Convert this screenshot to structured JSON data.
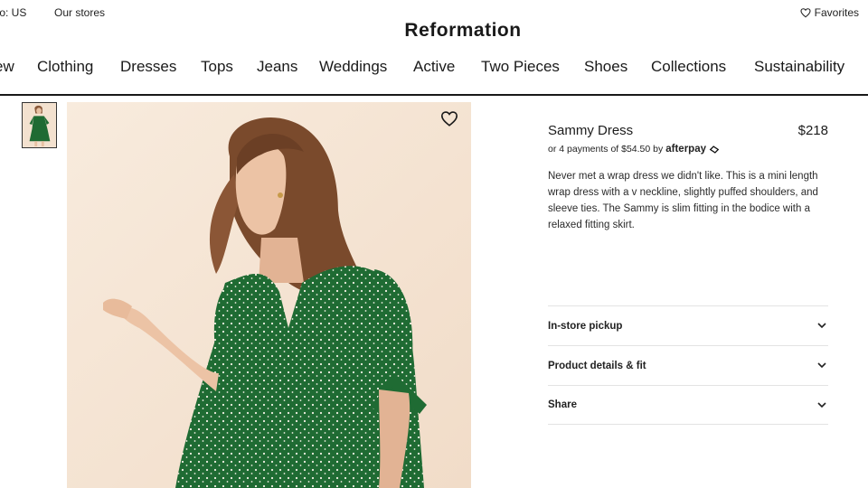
{
  "utility": {
    "ship_to": "to: US",
    "stores": "Our stores",
    "favorites": "Favorites"
  },
  "brand": {
    "logo": "Reformation"
  },
  "nav": {
    "items": [
      "ew",
      "Clothing",
      "Dresses",
      "Tops",
      "Jeans",
      "Weddings",
      "Active",
      "Two Pieces",
      "Shoes",
      "Collections",
      "Sustainability"
    ]
  },
  "gallery": {
    "thumbnail_alt": "Sammy Dress thumbnail",
    "favorite_icon": "heart-icon"
  },
  "product": {
    "name": "Sammy Dress",
    "price": "$218",
    "installments_prefix": "or 4 payments of $54.50 by",
    "installments_brand": "afterpay",
    "description": "Never met a wrap dress we didn't like. This is a mini length wrap dress with a v neckline, slightly puffed shoulders, and sleeve ties. The Sammy is slim fitting in the bodice with a relaxed fitting skirt."
  },
  "accordions": [
    {
      "label": "In-store pickup"
    },
    {
      "label": "Product details & fit"
    },
    {
      "label": "Share"
    }
  ],
  "colors": {
    "dress_green": "#1f6b33",
    "background_peach": "#f6e7d9",
    "text": "#191919"
  }
}
